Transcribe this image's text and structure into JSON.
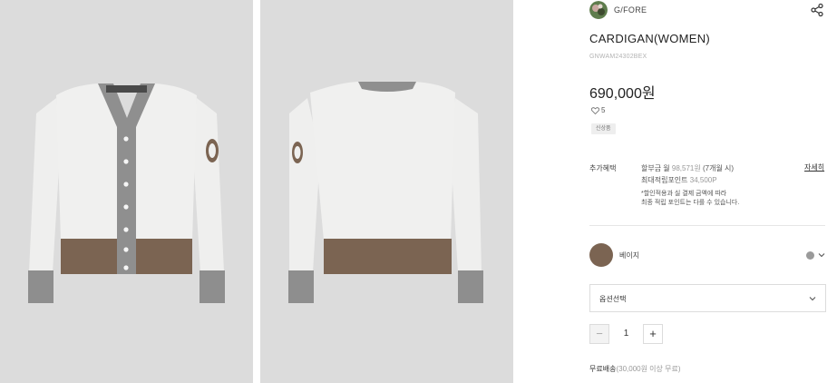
{
  "brand": {
    "name": "G/FORE",
    "logo_icon": "brand-avatar-icon"
  },
  "product": {
    "title": "CARDIGAN(WOMEN)",
    "sku": "GNWAM24302BEX",
    "price": "690,000원",
    "likes": "5",
    "tag": "신상품"
  },
  "benefit": {
    "label": "추가혜택",
    "line1_main": "할부금 월",
    "line1_amount": "98,571원",
    "line1_suffix": "(7개월 시)",
    "line2_main": "최대적립포인트",
    "line2_amount": "34,500P",
    "note1": "*할인적용과 실 결제 금액에 따라",
    "note2": "최종 적립 포인트는 다를 수 있습니다.",
    "detail_link": "자세히"
  },
  "color": {
    "name": "베이지",
    "swatch_hex": "#7b6452",
    "alt_hex": "#9a9a9a"
  },
  "option_select": {
    "label": "옵션선택"
  },
  "quantity": {
    "minus": "−",
    "value": "1",
    "plus": "+"
  },
  "shipping": {
    "main": "무료배송",
    "detail": "(30,000원 이상 무료)"
  },
  "icons": {
    "share": "share-icon",
    "heart": "heart-icon",
    "chevron": "chevron-down-icon"
  }
}
